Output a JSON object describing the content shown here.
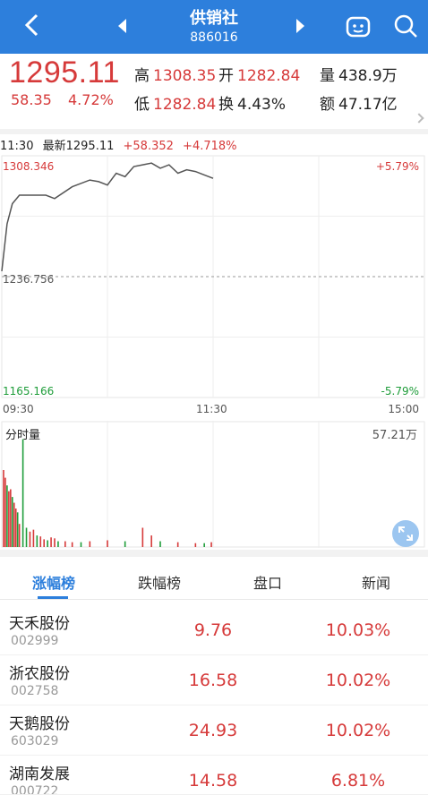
{
  "header": {
    "title": "供销社",
    "code": "886016",
    "icons": [
      "back-icon",
      "prev-stock-icon",
      "next-stock-icon",
      "robot-assistant-icon",
      "search-icon"
    ]
  },
  "quote": {
    "price": "1295.11",
    "change": "58.35",
    "change_pct": "4.72%",
    "high_label": "高",
    "high": "1308.35",
    "open_label": "开",
    "open": "1282.84",
    "volume_label": "量",
    "volume": "438.9万",
    "low_label": "低",
    "low": "1282.84",
    "turnover_label": "换",
    "turnover": "4.43%",
    "amount_label": "额",
    "amount": "47.17亿"
  },
  "intraday": {
    "time": "11:30",
    "latest_label": "最新1295.11",
    "change": "+58.352",
    "change_pct": "+4.718%",
    "y_top": "1308.346",
    "y_mid": "1236.756",
    "y_bottom": "1165.166",
    "pct_top": "+5.79%",
    "pct_bottom": "-5.79%",
    "x_start": "09:30",
    "x_mid": "11:30",
    "x_end": "15:00"
  },
  "volume": {
    "title": "分时量",
    "max": "57.21万"
  },
  "tabs": {
    "items": [
      "涨幅榜",
      "跌幅榜",
      "盘口",
      "新闻"
    ],
    "active": "涨幅榜"
  },
  "list": [
    {
      "name": "天禾股份",
      "code": "002999",
      "price": "9.76",
      "pct": "10.03%"
    },
    {
      "name": "浙农股份",
      "code": "002758",
      "price": "16.58",
      "pct": "10.02%"
    },
    {
      "name": "天鹅股份",
      "code": "603029",
      "price": "24.93",
      "pct": "10.02%"
    },
    {
      "name": "湖南发展",
      "code": "000722",
      "price": "14.58",
      "pct": "6.81%"
    }
  ],
  "colors": {
    "brand": "#2d7fdc",
    "up": "#d63a3a",
    "down": "#1f9d3a"
  },
  "chart_data": {
    "type": "line",
    "title": "",
    "xlabel": "",
    "ylabel": "",
    "x_ticks": [
      "09:30",
      "11:30",
      "15:00"
    ],
    "ylim": [
      1165.166,
      1308.346
    ],
    "prev_close": 1236.756,
    "price_series": {
      "x_minutes": [
        0,
        3,
        6,
        10,
        15,
        20,
        25,
        30,
        40,
        50,
        55,
        60,
        65,
        70,
        75,
        80,
        85,
        90,
        95,
        100,
        105,
        110,
        115,
        120
      ],
      "values": [
        1240,
        1268,
        1280,
        1285,
        1285,
        1285,
        1285,
        1283,
        1290,
        1294,
        1293,
        1291,
        1298,
        1296,
        1302,
        1303,
        1304,
        1301,
        1303,
        1298,
        1300,
        1299,
        1297,
        1295
      ]
    },
    "volume_series": {
      "max": 572100,
      "x_minutes": [
        1,
        2,
        3,
        4,
        5,
        6,
        7,
        8,
        9,
        10,
        12,
        14,
        16,
        18,
        20,
        22,
        24,
        26,
        28,
        30,
        32,
        36,
        40,
        45,
        50,
        60,
        70,
        80,
        85,
        90,
        100,
        110,
        115,
        119
      ],
      "values": [
        400000,
        360000,
        320000,
        290000,
        300000,
        260000,
        230000,
        200000,
        180000,
        120000,
        560000,
        100000,
        80000,
        90000,
        60000,
        55000,
        40000,
        35000,
        50000,
        45000,
        30000,
        30000,
        25000,
        25000,
        30000,
        35000,
        30000,
        100000,
        60000,
        30000,
        25000,
        20000,
        20000,
        25000
      ]
    }
  }
}
